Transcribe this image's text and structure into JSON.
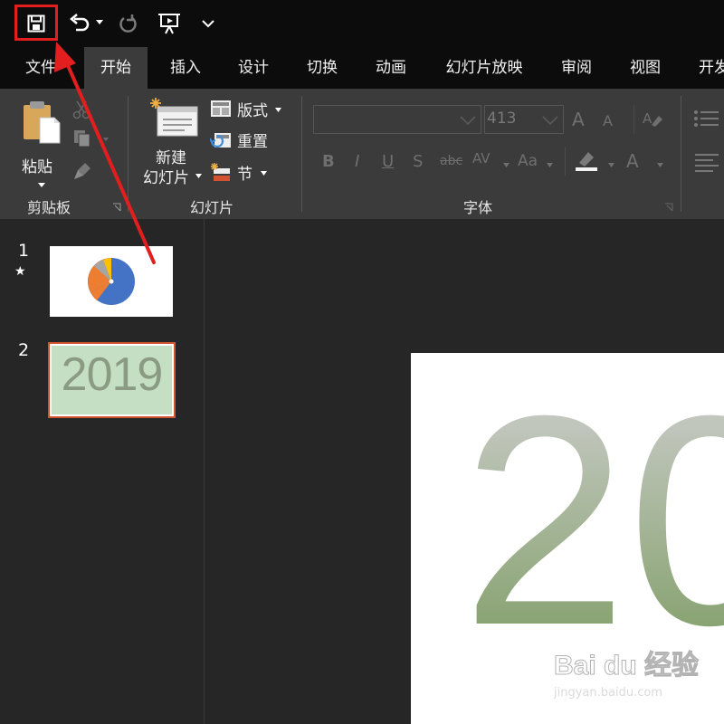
{
  "quick_access": {
    "save_icon": "floppy-disk",
    "undo_icon": "undo-arrow",
    "redo_icon": "redo-arrow",
    "present_icon": "present-from-beginning",
    "customize_icon": "chevron-down",
    "highlight_color": "#e21e1e"
  },
  "tabs": [
    "文件",
    "开始",
    "插入",
    "设计",
    "切换",
    "动画",
    "幻灯片放映",
    "审阅",
    "视图",
    "开发"
  ],
  "active_tab": "开始",
  "clipboard": {
    "paste_label": "粘贴",
    "group_label": "剪贴板"
  },
  "slides_group": {
    "new_slide_line1": "新建",
    "new_slide_line2": "幻灯片",
    "layout_label": "版式",
    "reset_label": "重置",
    "section_label": "节",
    "group_label": "幻灯片"
  },
  "font_group": {
    "font_name": "",
    "font_size": "413",
    "bold": "B",
    "italic": "I",
    "underline": "U",
    "shadow": "S",
    "strikethrough": "abc",
    "spacing": "AV",
    "change_case": "Aa",
    "font_color": "A",
    "grow": "A",
    "shrink": "A",
    "group_label": "字体"
  },
  "thumbnails": [
    {
      "number": "1",
      "has_animation_star": true
    },
    {
      "number": "2",
      "text": "2019",
      "selected": true
    }
  ],
  "slide_main_text": "20",
  "watermark": {
    "logo": "Bai du 经验",
    "url": "jingyan.baidu.com"
  },
  "colors": {
    "accent_border": "#d35230",
    "annotation_red": "#e21e1e"
  }
}
